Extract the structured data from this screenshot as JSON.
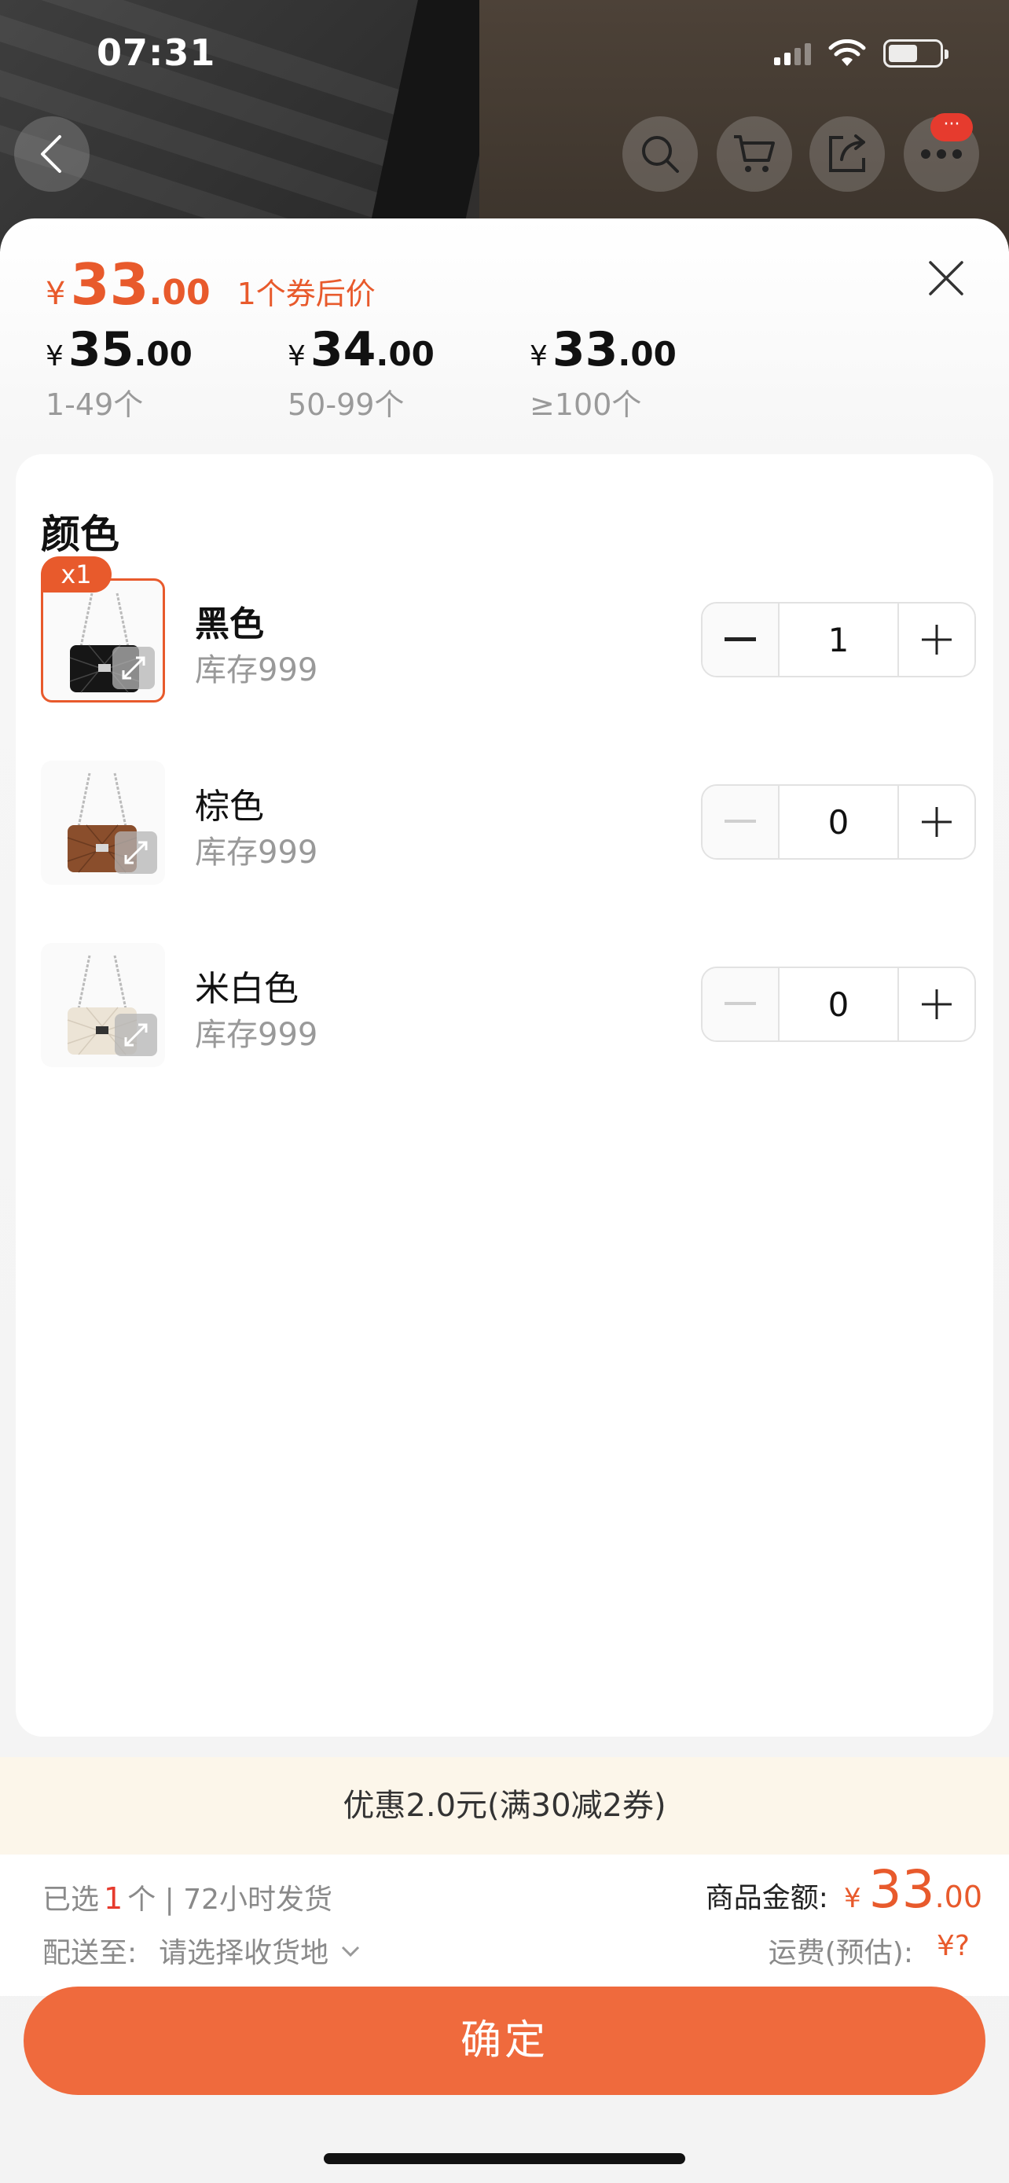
{
  "status_bar": {
    "time": "07:31"
  },
  "header": {
    "notification_badge": "···"
  },
  "price": {
    "yen": "¥",
    "integer": "33",
    "decimal": ".00",
    "coupon_label": "1个券后价"
  },
  "tiers": [
    {
      "yen": "¥",
      "integer": "35",
      "decimal": ".00",
      "range": "1-49个"
    },
    {
      "yen": "¥",
      "integer": "34",
      "decimal": ".00",
      "range": "50-99个"
    },
    {
      "yen": "¥",
      "integer": "33",
      "decimal": ".00",
      "range": "≥100个"
    }
  ],
  "section": {
    "title": "颜色"
  },
  "variants": [
    {
      "name": "黑色",
      "stock": "库存999",
      "qty": "1",
      "badge": "x1"
    },
    {
      "name": "棕色",
      "stock": "库存999",
      "qty": "0"
    },
    {
      "name": "米白色",
      "stock": "库存999",
      "qty": "0"
    }
  ],
  "promo": "优惠2.0元(满30减2券)",
  "summary": {
    "selected_prefix": "已选",
    "selected_count": "1",
    "selected_suffix": "个 | 72小时发货",
    "ship_label": "配送至:",
    "ship_value": "请选择收货地",
    "amount_label": "商品金额:",
    "amount_yen": "¥",
    "amount_integer": "33",
    "amount_decimal": ".00",
    "freight_label": "运费(预估):",
    "freight_value": "¥?"
  },
  "confirm_label": "确定",
  "colors": {
    "accent": "#e85a2c",
    "confirm": "#ef6a3d",
    "promo_bg": "#fcf6ea"
  }
}
